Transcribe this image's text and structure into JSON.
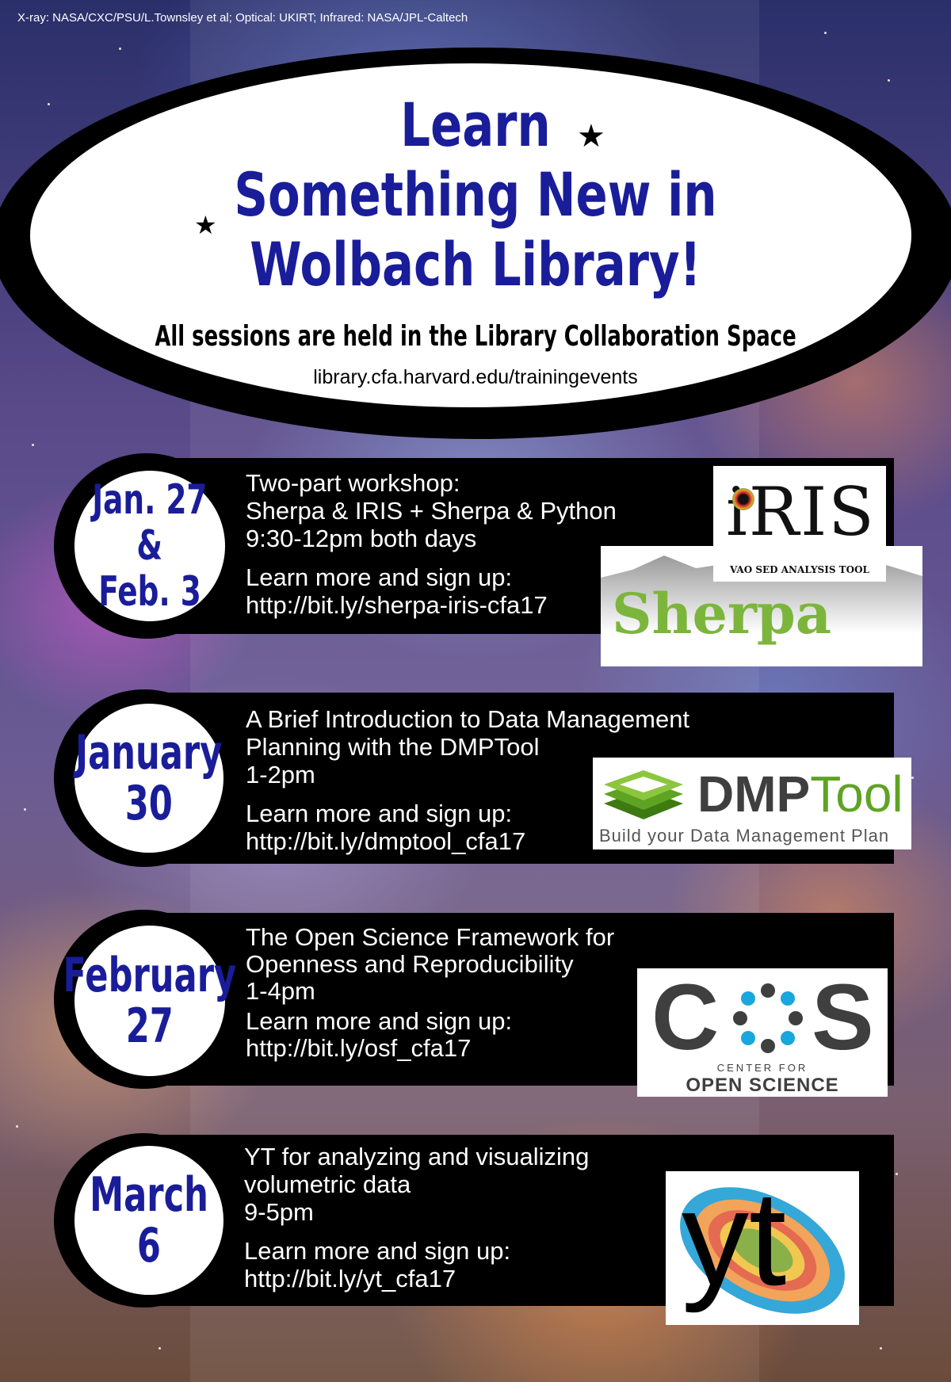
{
  "credit": "X-ray: NASA/CXC/PSU/L.Townsley et al; Optical: UKIRT; Infrared: NASA/JPL-Caltech",
  "header": {
    "title_lines": [
      "Learn",
      "Something New in",
      "Wolbach Library!"
    ],
    "subtitle": "All sessions are held in the Library Collaboration Space",
    "url": "library.cfa.harvard.edu/trainingevents"
  },
  "events": [
    {
      "date_lines": [
        "Jan. 27",
        "&",
        "Feb. 3"
      ],
      "lines": [
        "Two-part workshop:",
        "Sherpa & IRIS + Sherpa & Python",
        "9:30-12pm both days"
      ],
      "signup_label": "Learn more and sign up:",
      "link": "http://bit.ly/sherpa-iris-cfa17",
      "logos": [
        {
          "text": "iRIS",
          "caption": "VAO SED ANALYSIS TOOL"
        },
        {
          "text": "Sherpa"
        }
      ]
    },
    {
      "date_lines": [
        "January",
        "30"
      ],
      "lines": [
        "A Brief Introduction to Data Management",
        "Planning with the DMPTool",
        "1-2pm"
      ],
      "signup_label": "Learn more and sign up:",
      "link": "http://bit.ly/dmptool_cfa17",
      "logos": [
        {
          "text_a": "DMP",
          "text_b": "Tool",
          "caption": "Build your Data Management Plan"
        }
      ]
    },
    {
      "date_lines": [
        "February",
        "27"
      ],
      "lines": [
        "The Open Science Framework for",
        "Openness and Reproducibility",
        "1-4pm"
      ],
      "signup_label": "Learn more and sign up:",
      "link": "http://bit.ly/osf_cfa17",
      "logos": [
        {
          "text_a": "C",
          "text_b": "S",
          "caption_small": "CENTER FOR",
          "caption": "OPEN SCIENCE"
        }
      ]
    },
    {
      "date_lines": [
        "March",
        "6"
      ],
      "lines": [
        "YT for analyzing and visualizing",
        "volumetric data",
        "9-5pm"
      ],
      "signup_label": "Learn more and sign up:",
      "link": "http://bit.ly/yt_cfa17",
      "logos": [
        {
          "text": "yt"
        }
      ]
    }
  ],
  "colors": {
    "title_blue": "#1a1d99",
    "sherpa_green": "#7cb53c",
    "dmp_green": "#5fa323",
    "cos_blue": "#19a7dd",
    "cos_gray": "#3f3f3f"
  }
}
